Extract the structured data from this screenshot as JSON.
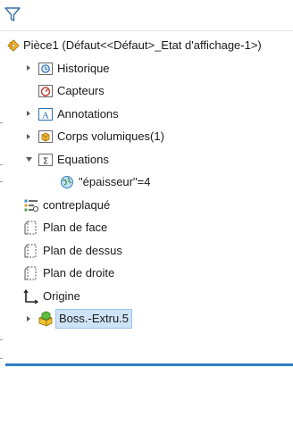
{
  "tree": {
    "part": {
      "label": "Pièce1  (Défaut<<Défaut>_Etat d'affichage-1>)",
      "icon": "part-icon"
    },
    "items": [
      {
        "label": "Historique",
        "icon": "history-icon",
        "expandable": true,
        "expanded": false
      },
      {
        "label": "Capteurs",
        "icon": "sensors-icon",
        "expandable": false
      },
      {
        "label": "Annotations",
        "icon": "annotations-icon",
        "expandable": true,
        "expanded": false
      },
      {
        "label": "Corps volumiques(1)",
        "icon": "solid-bodies-icon",
        "expandable": true,
        "expanded": false
      },
      {
        "label": "Equations",
        "icon": "equations-icon",
        "expandable": true,
        "expanded": true
      },
      {
        "label": "\"épaisseur\"=4",
        "icon": "global-variable-icon",
        "expandable": false
      },
      {
        "label": "contreplaqué",
        "icon": "material-icon",
        "expandable": false
      },
      {
        "label": "Plan de face",
        "icon": "plane-icon",
        "expandable": false
      },
      {
        "label": "Plan de dessus",
        "icon": "plane-icon",
        "expandable": false
      },
      {
        "label": "Plan de droite",
        "icon": "plane-icon",
        "expandable": false
      },
      {
        "label": "Origine",
        "icon": "origin-icon",
        "expandable": false
      },
      {
        "label": "Boss.-Extru.5",
        "icon": "boss-extrude-icon",
        "expandable": true,
        "expanded": false,
        "selected": true
      }
    ]
  },
  "colors": {
    "selection_fill": "#cfe3f7",
    "rollback_bar": "#2f7ec3"
  }
}
